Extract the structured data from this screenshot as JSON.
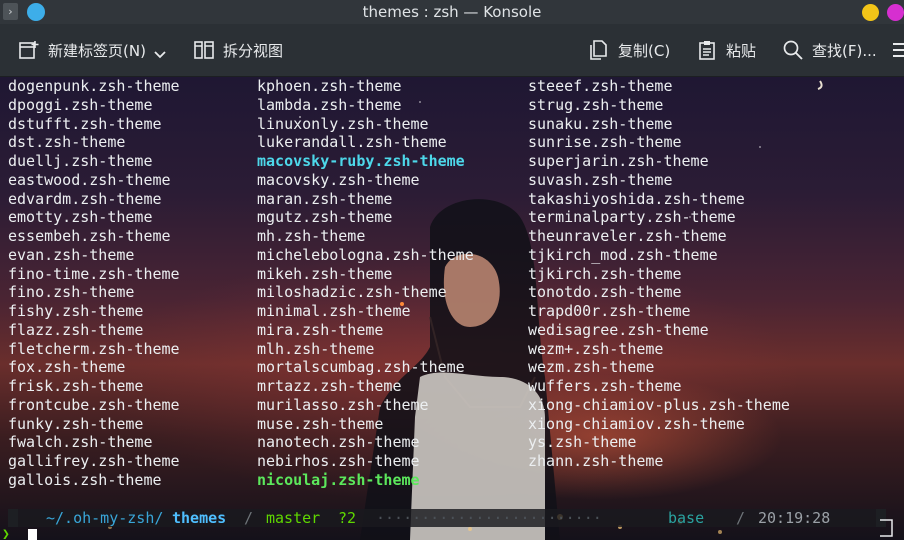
{
  "window": {
    "title": "themes : zsh — Konsole",
    "menu_glyph": "›",
    "colors": {
      "minimize": "#f2c418",
      "maximize": "#d62fd0",
      "pin": "#3daee9"
    }
  },
  "toolbar": {
    "new_tab_label": "新建标签页(N)",
    "split_view_label": "拆分视图",
    "copy_label": "复制(C)",
    "paste_label": "粘贴",
    "find_label": "查找(F)..."
  },
  "terminal": {
    "col1": [
      "dogenpunk.zsh-theme",
      "dpoggi.zsh-theme",
      "dstufft.zsh-theme",
      "dst.zsh-theme",
      "duellj.zsh-theme",
      "eastwood.zsh-theme",
      "edvardm.zsh-theme",
      "emotty.zsh-theme",
      "essembeh.zsh-theme",
      "evan.zsh-theme",
      "fino-time.zsh-theme",
      "fino.zsh-theme",
      "fishy.zsh-theme",
      "flazz.zsh-theme",
      "fletcherm.zsh-theme",
      "fox.zsh-theme",
      "frisk.zsh-theme",
      "frontcube.zsh-theme",
      "funky.zsh-theme",
      "fwalch.zsh-theme",
      "gallifrey.zsh-theme",
      "gallois.zsh-theme"
    ],
    "col2": [
      "kphoen.zsh-theme",
      "lambda.zsh-theme",
      "linuxonly.zsh-theme",
      "lukerandall.zsh-theme",
      "macovsky-ruby.zsh-theme",
      "macovsky.zsh-theme",
      "maran.zsh-theme",
      "mgutz.zsh-theme",
      "mh.zsh-theme",
      "michelebologna.zsh-theme",
      "mikeh.zsh-theme",
      "miloshadzic.zsh-theme",
      "minimal.zsh-theme",
      "mira.zsh-theme",
      "mlh.zsh-theme",
      "mortalscumbag.zsh-theme",
      "mrtazz.zsh-theme",
      "murilasso.zsh-theme",
      "muse.zsh-theme",
      "nanotech.zsh-theme",
      "nebirhos.zsh-theme",
      "nicoulaj.zsh-theme"
    ],
    "col3": [
      "steeef.zsh-theme",
      "strug.zsh-theme",
      "sunaku.zsh-theme",
      "sunrise.zsh-theme",
      "superjarin.zsh-theme",
      "suvash.zsh-theme",
      "takashiyoshida.zsh-theme",
      "terminalparty.zsh-theme",
      "theunraveler.zsh-theme",
      "tjkirch_mod.zsh-theme",
      "tjkirch.zsh-theme",
      "tonotdo.zsh-theme",
      "trapd00r.zsh-theme",
      "wedisagree.zsh-theme",
      "wezm+.zsh-theme",
      "wezm.zsh-theme",
      "wuffers.zsh-theme",
      "xiong-chiamiov-plus.zsh-theme",
      "xiong-chiamiov.zsh-theme",
      "ys.zsh-theme",
      "zhann.zsh-theme"
    ],
    "highlight_cyan": "macovsky-ruby.zsh-theme",
    "highlight_green": "nicoulaj.zsh-theme",
    "colors": {
      "text": "#eceff1",
      "cyan": "#4dd8ea",
      "green": "#5ce85c"
    }
  },
  "prompt": {
    "path_prefix": "~/.oh-my-zsh/",
    "path_dir": "themes",
    "separator": "/",
    "git_branch": "master",
    "git_status": "?2",
    "dots": "·························",
    "env": "base",
    "env_icon": "",
    "time": "20:19:28",
    "caret": "❯"
  }
}
